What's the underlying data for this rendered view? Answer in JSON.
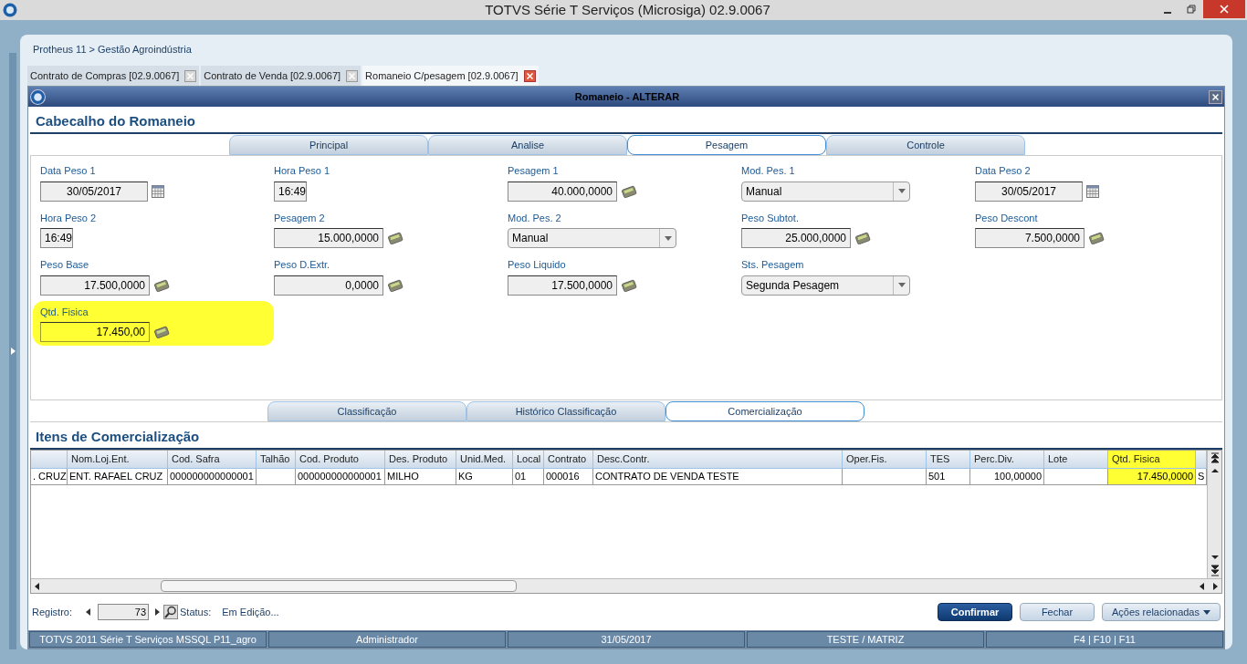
{
  "app_title": "TOTVS Série T Serviços (Microsiga) 02.9.0067",
  "breadcrumb": "Protheus 11 > Gestão Agroindústria",
  "doc_tabs": [
    {
      "label": "Contrato de Compras [02.9.0067]",
      "selected": false
    },
    {
      "label": "Contrato de Venda [02.9.0067]",
      "selected": false
    },
    {
      "label": "Romaneio C/pesagem [02.9.0067]",
      "selected": true
    }
  ],
  "dialog": {
    "title": "Romaneio - ALTERAR",
    "header_section": "Cabecalho do Romaneio",
    "top_tabs": [
      {
        "label": "Principal",
        "selected": false
      },
      {
        "label": "Analise",
        "selected": false
      },
      {
        "label": "Pesagem",
        "selected": true
      },
      {
        "label": "Controle",
        "selected": false
      }
    ],
    "field_rows": [
      [
        {
          "label": "Data Peso 1",
          "value": "30/05/2017",
          "kind": "date"
        },
        {
          "label": "Hora Peso 1",
          "value": "16:49",
          "kind": "time"
        },
        {
          "label": "Pesagem 1",
          "value": "40.000,0000",
          "kind": "number"
        },
        {
          "label": "Mod. Pes. 1",
          "value": "Manual",
          "kind": "select"
        },
        {
          "label": "Data Peso 2",
          "value": "30/05/2017",
          "kind": "date"
        }
      ],
      [
        {
          "label": "Hora Peso 2",
          "value": "16:49",
          "kind": "time"
        },
        {
          "label": "Pesagem 2",
          "value": "15.000,0000",
          "kind": "number"
        },
        {
          "label": "Mod. Pes. 2",
          "value": "Manual",
          "kind": "select"
        },
        {
          "label": "Peso Subtot.",
          "value": "25.000,0000",
          "kind": "number"
        },
        {
          "label": "Peso Descont",
          "value": "7.500,0000",
          "kind": "number"
        }
      ],
      [
        {
          "label": "Peso Base",
          "value": "17.500,0000",
          "kind": "number"
        },
        {
          "label": "Peso D.Extr.",
          "value": "0,0000",
          "kind": "number"
        },
        {
          "label": "Peso Liquido",
          "value": "17.500,0000",
          "kind": "number"
        },
        {
          "label": "Sts. Pesagem",
          "value": "Segunda Pesagem",
          "kind": "select"
        }
      ],
      [
        {
          "label": "Qtd. Fisica",
          "value": "17.450,00",
          "kind": "number",
          "highlighted": true
        }
      ]
    ],
    "bottom_tabs": [
      {
        "label": "Classificação",
        "selected": false
      },
      {
        "label": "Histórico Classificação",
        "selected": false
      },
      {
        "label": "Comercialização",
        "selected": true
      }
    ],
    "items_section": "Itens de Comercialização",
    "table": {
      "columns": [
        {},
        {
          "header": "Nom.Loj.Ent."
        },
        {
          "header": "Cod. Safra"
        },
        {
          "header": "Talhão"
        },
        {
          "header": "Cod. Produto"
        },
        {
          "header": "Des. Produto"
        },
        {
          "header": "Unid.Med."
        },
        {
          "header": "Local"
        },
        {
          "header": "Contrato"
        },
        {
          "header": "Desc.Contr."
        },
        {
          "header": "Oper.Fis."
        },
        {
          "header": "TES"
        },
        {
          "header": "Perc.Div."
        },
        {
          "header": "Lote"
        },
        {
          "header": "Qtd. Fisica",
          "highlighted": true
        },
        {}
      ],
      "rows": [
        [
          ". CRUZ",
          "ENT. RAFAEL CRUZ",
          "000000000000001",
          "",
          "000000000000001",
          "MILHO",
          "KG",
          "01",
          "000016",
          "CONTRATO DE VENDA TESTE",
          "",
          "501",
          "100,00000",
          "",
          "17.450,0000",
          "S"
        ]
      ]
    },
    "footer": {
      "registro_label": "Registro:",
      "registro_value": "73",
      "status_label": "Status:",
      "status_value": "Em Edição...",
      "buttons": [
        {
          "label": "Confirmar",
          "kind": "primary"
        },
        {
          "label": "Fechar",
          "kind": "plain"
        },
        {
          "label": "Ações relacionadas",
          "kind": "menu"
        }
      ]
    }
  },
  "status_bar": [
    "TOTVS 2011 Série T Serviços MSSQL P11_agro",
    "Administrador",
    "31/05/2017",
    "TESTE / MATRIZ",
    "F4 | F10 | F11"
  ]
}
